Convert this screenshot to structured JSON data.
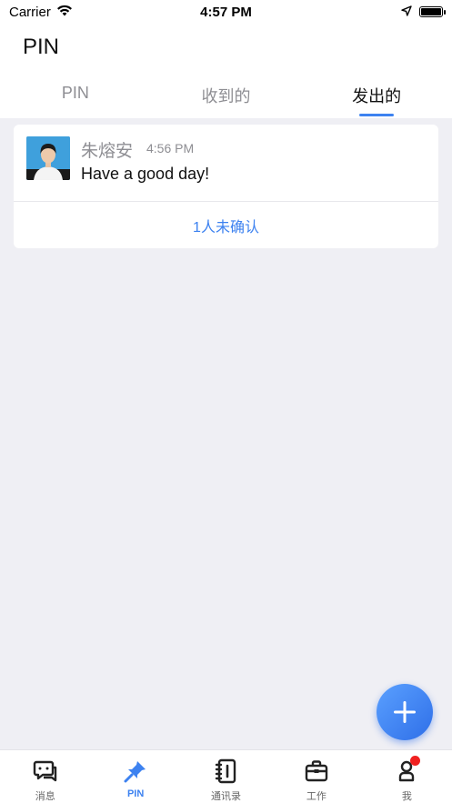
{
  "status_bar": {
    "carrier": "Carrier",
    "time": "4:57 PM"
  },
  "header": {
    "title": "PIN",
    "tabs": [
      {
        "label": "PIN",
        "active": false
      },
      {
        "label": "收到的",
        "active": false
      },
      {
        "label": "发出的",
        "active": true
      }
    ]
  },
  "pin_card": {
    "sender": "朱熔安",
    "time": "4:56 PM",
    "message": "Have a good day!",
    "unconfirmed_label": "1人未确认"
  },
  "tabbar": {
    "items": [
      {
        "label": "消息",
        "icon": "chat-icon",
        "active": false
      },
      {
        "label": "PIN",
        "icon": "pin-icon",
        "active": true
      },
      {
        "label": "通讯录",
        "icon": "contacts-book-icon",
        "active": false
      },
      {
        "label": "工作",
        "icon": "briefcase-icon",
        "active": false
      },
      {
        "label": "我",
        "icon": "user-icon",
        "active": false,
        "badge": true
      }
    ]
  },
  "colors": {
    "accent": "#3d82f0",
    "badge": "#f02020",
    "background": "#efeff4"
  }
}
